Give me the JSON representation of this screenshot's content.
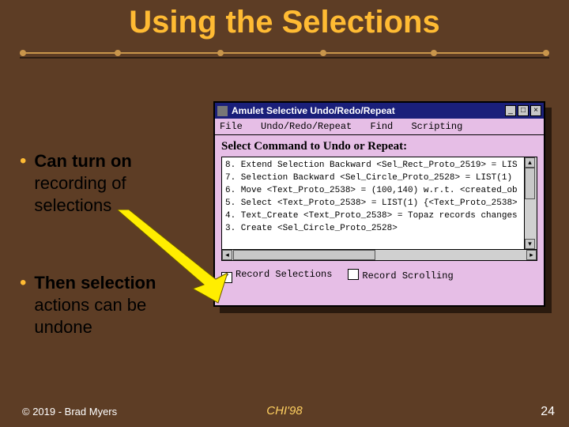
{
  "title": "Using the Selections",
  "bullets": [
    {
      "bold": "Can turn on",
      "rest": "recording of selections"
    },
    {
      "bold": "Then selection",
      "rest": "actions can be undone"
    }
  ],
  "footer": {
    "left": "© 2019 - Brad Myers",
    "center": "CHI'98",
    "right": "24"
  },
  "window": {
    "title": "Amulet Selective Undo/Redo/Repeat",
    "menu": [
      "File",
      "Undo/Redo/Repeat",
      "Find",
      "Scripting"
    ],
    "heading": "Select Command to Undo or Repeat:",
    "items": [
      "8.  Extend Selection Backward <Sel_Rect_Proto_2519> = LIS",
      "7.  Selection Backward <Sel_Circle_Proto_2528> = LIST(1)",
      "6.  Move <Text_Proto_2538> = (100,140) w.r.t. <created_ob",
      "5.  Select <Text_Proto_2538> = LIST(1) {<Text_Proto_2538>",
      "4.  Text_Create <Text_Proto_2538> = Topaz records changes",
      "3.  Create <Sel_Circle_Proto_2528>"
    ],
    "checks": [
      {
        "label": "Record Selections",
        "checked": true
      },
      {
        "label": "Record Scrolling",
        "checked": false
      }
    ],
    "buttons": {
      "min": "_",
      "max": "□",
      "close": "×"
    },
    "scroll": {
      "up": "▴",
      "down": "▾",
      "left": "◂",
      "right": "▸"
    }
  }
}
